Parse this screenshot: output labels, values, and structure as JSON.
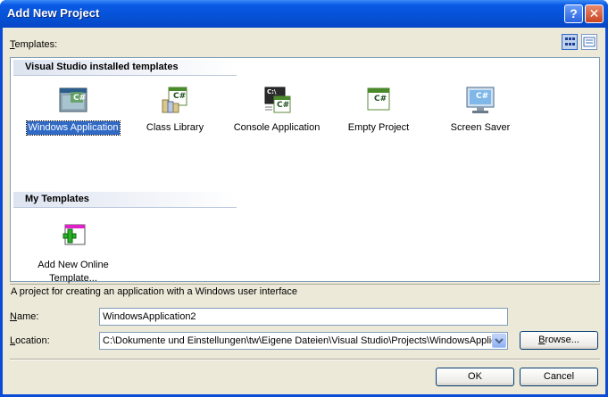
{
  "window": {
    "title": "Add New Project",
    "help_glyph": "?",
    "close_glyph": "✕"
  },
  "templates_label_prefix": "T",
  "templates_label_rest": "emplates:",
  "sections": {
    "installed": "Visual Studio installed templates",
    "mine": "My Templates"
  },
  "installed_templates": [
    {
      "label": "Windows Application",
      "icon": "windows-application-icon",
      "selected": true
    },
    {
      "label": "Class Library",
      "icon": "class-library-icon",
      "selected": false
    },
    {
      "label": "Console Application",
      "icon": "console-application-icon",
      "selected": false
    },
    {
      "label": "Empty Project",
      "icon": "empty-project-icon",
      "selected": false
    },
    {
      "label": "Screen Saver",
      "icon": "screen-saver-icon",
      "selected": false
    }
  ],
  "my_templates": [
    {
      "label_line1": "Add New Online",
      "label_line2": "Template...",
      "icon": "add-online-template-icon"
    }
  ],
  "description": "A project for creating an application with a Windows user interface",
  "name_field": {
    "label_prefix": "N",
    "label_rest": "ame:",
    "value": "WindowsApplication2"
  },
  "location_field": {
    "label_prefix": "L",
    "label_rest": "ocation:",
    "value": "C:\\Dokumente und Einstellungen\\tw\\Eigene Dateien\\Visual Studio\\Projects\\WindowsApplic"
  },
  "buttons": {
    "browse_prefix": "B",
    "browse_rest": "rowse...",
    "ok": "OK",
    "cancel": "Cancel"
  },
  "icon_text": {
    "csharp": "C#",
    "console": "C:\\"
  },
  "colors": {
    "title_blue": "#0653d8",
    "selection": "#316ac5",
    "dialog_bg": "#ece9d8"
  }
}
